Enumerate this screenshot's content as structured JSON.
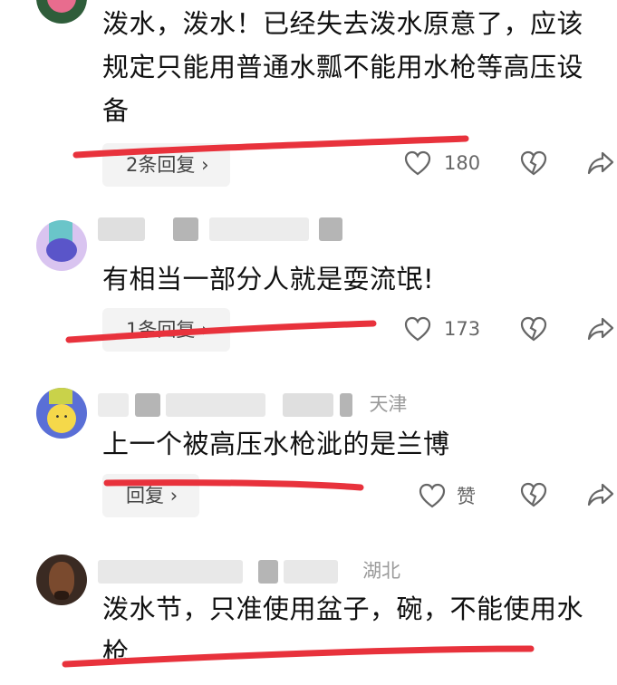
{
  "comments": [
    {
      "text": "泼水，泼水！已经失去泼水原意了，应该规定只能用普通水瓢不能用水枪等高压设备",
      "reply_label": "2条回复",
      "like_count": "180"
    },
    {
      "location": "",
      "text": "有相当一部分人就是耍流氓!",
      "reply_label": "1条回复",
      "like_count": "173"
    },
    {
      "location": "天津",
      "text": "上一个被高压水枪泚的是兰博",
      "reply_label": "回复",
      "like_count": "赞"
    },
    {
      "location": "湖北",
      "text": "泼水节，只准使用盆子，碗，不能使用水枪"
    }
  ],
  "icons": {
    "like": "heart-outline",
    "dislike": "broken-heart",
    "share": "share-arrow",
    "chevron": "chevron-right"
  },
  "colors": {
    "annotation": "#e8323c",
    "reply_bg": "#f3f3f3",
    "meta": "#9a9a9a"
  }
}
